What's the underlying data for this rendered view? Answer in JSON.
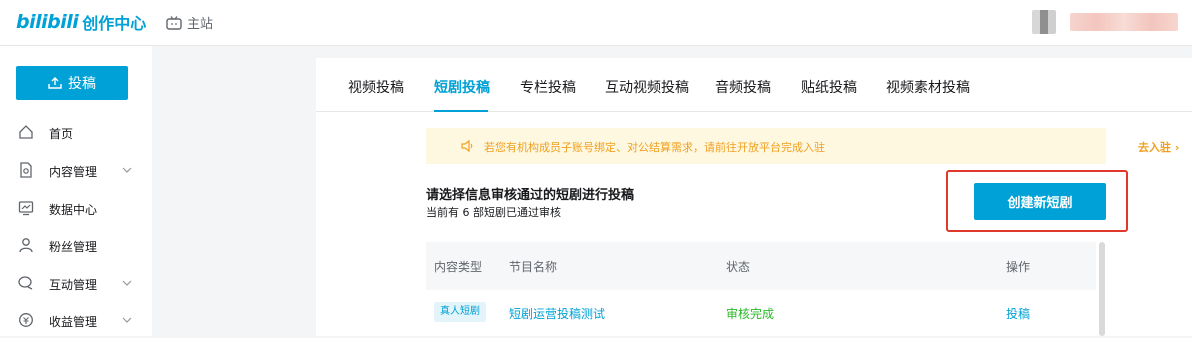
{
  "header": {
    "logo_bili": "bilibili",
    "logo_text": "创作中心",
    "home_label": "主站"
  },
  "sidebar": {
    "post_label": "投稿",
    "items": [
      {
        "label": "首页",
        "icon": "home-icon",
        "has_chevron": false
      },
      {
        "label": "内容管理",
        "icon": "document-icon",
        "has_chevron": true
      },
      {
        "label": "数据中心",
        "icon": "chart-icon",
        "has_chevron": false
      },
      {
        "label": "粉丝管理",
        "icon": "user-icon",
        "has_chevron": false
      },
      {
        "label": "互动管理",
        "icon": "chat-icon",
        "has_chevron": true
      },
      {
        "label": "收益管理",
        "icon": "coin-icon",
        "has_chevron": true
      }
    ]
  },
  "tabs": [
    {
      "label": "视频投稿",
      "active": false
    },
    {
      "label": "短剧投稿",
      "active": true
    },
    {
      "label": "专栏投稿",
      "active": false
    },
    {
      "label": "互动视频投稿",
      "active": false
    },
    {
      "label": "音频投稿",
      "active": false
    },
    {
      "label": "贴纸投稿",
      "active": false
    },
    {
      "label": "视频素材投稿",
      "active": false
    }
  ],
  "notice": {
    "text": "若您有机构成员子账号绑定、对公结算需求，请前往开放平台完成入驻",
    "link": "去入驻 ›"
  },
  "section": {
    "title": "请选择信息审核通过的短剧进行投稿",
    "subtitle": "当前有 6 部短剧已通过审核",
    "create_label": "创建新短剧"
  },
  "table": {
    "headers": [
      "内容类型",
      "节目名称",
      "状态",
      "操作"
    ],
    "rows": [
      {
        "type": "真人短剧",
        "name": "短剧运营投稿测试",
        "status": "审核完成",
        "action": "投稿"
      }
    ]
  },
  "colors": {
    "accent": "#00a1d6",
    "success": "#2ab82a",
    "notice_text": "#f0a020",
    "highlight_outline": "#e0382b"
  }
}
